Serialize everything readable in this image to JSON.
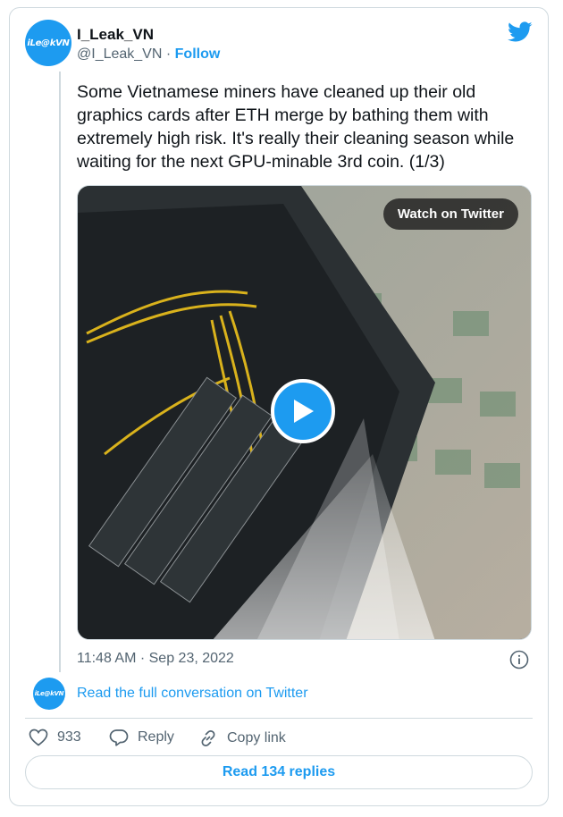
{
  "author": {
    "avatar_text": "iLe@kVN",
    "name": "I_Leak_VN",
    "handle": "@I_Leak_VN",
    "separator": "·",
    "follow_label": "Follow"
  },
  "tweet": {
    "text": "Some Vietnamese miners have cleaned up their old graphics cards after ETH merge by bathing them with extremely high risk. It's really their cleaning season while waiting for the next GPU-minable 3rd coin. (1/3)",
    "timestamp": "11:48 AM · Sep 23, 2022"
  },
  "media": {
    "watch_label": "Watch on Twitter",
    "play_icon": "play-icon"
  },
  "conversation": {
    "avatar_text": "iLe@kVN",
    "link_label": "Read the full conversation on Twitter"
  },
  "actions": {
    "like_count": "933",
    "reply_label": "Reply",
    "copy_label": "Copy link"
  },
  "read_replies_label": "Read 134 replies",
  "colors": {
    "accent": "#1d9bf0",
    "secondary_text": "#536471",
    "border": "#cfd9de"
  }
}
